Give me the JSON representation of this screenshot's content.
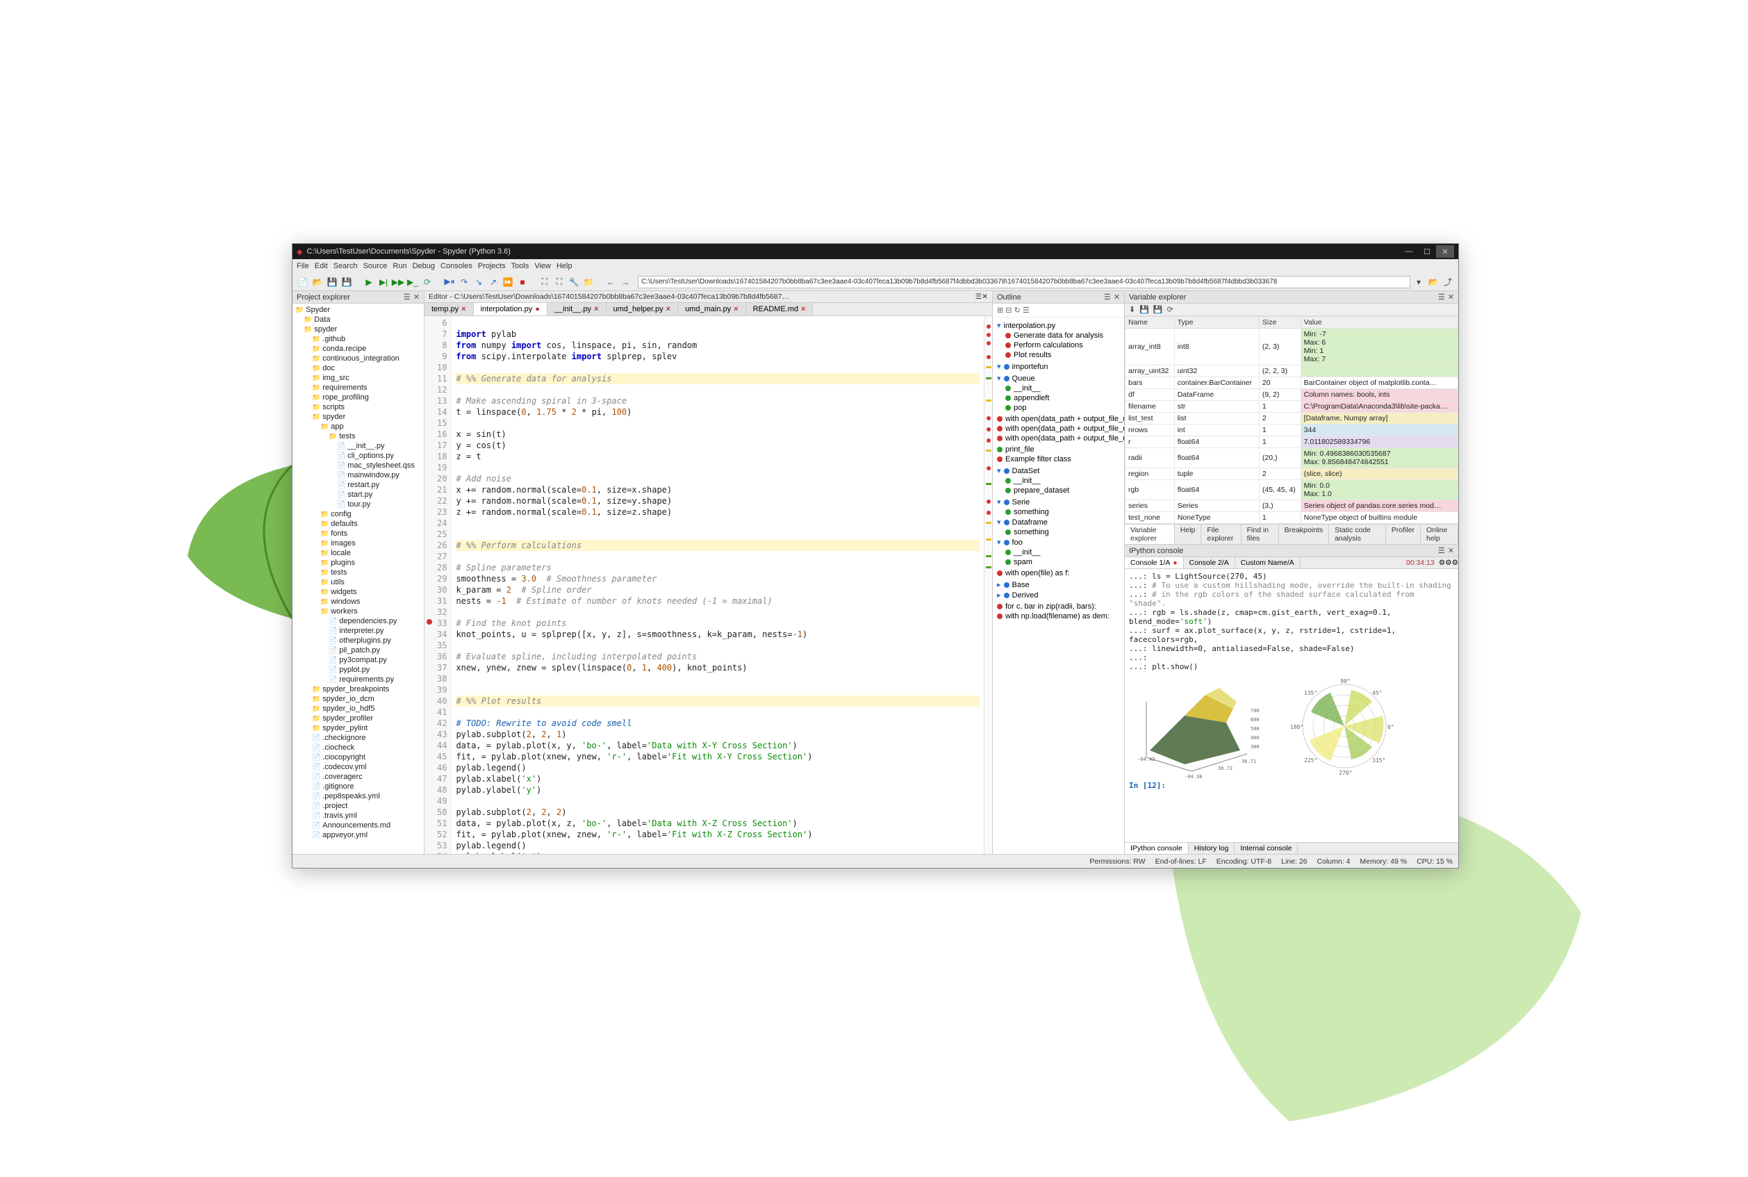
{
  "window": {
    "title": "C:\\Users\\TestUser\\Documents\\Spyder - Spyder (Python 3.6)"
  },
  "menubar": [
    "File",
    "Edit",
    "Search",
    "Source",
    "Run",
    "Debug",
    "Consoles",
    "Projects",
    "Tools",
    "View",
    "Help"
  ],
  "toolbar": {
    "path": "C:\\Users\\TestUser\\Downloads\\167401584207b0bb8ba67c3ee3aae4-03c407feca13b09b7b8d4fb5687f4dbbd3b033678\\167401584207b0bb8ba67c3ee3aae4-03c407feca13b09b7b8d4fb5687f4dbbd3b033678"
  },
  "project_explorer": {
    "title": "Project explorer",
    "tree": [
      {
        "lvl": 0,
        "label": "Spyder",
        "type": "folder"
      },
      {
        "lvl": 1,
        "label": "Data",
        "type": "folder"
      },
      {
        "lvl": 1,
        "label": "spyder",
        "type": "folder"
      },
      {
        "lvl": 2,
        "label": ".github",
        "type": "folder"
      },
      {
        "lvl": 2,
        "label": "conda.recipe",
        "type": "folder"
      },
      {
        "lvl": 2,
        "label": "continuous_integration",
        "type": "folder"
      },
      {
        "lvl": 2,
        "label": "doc",
        "type": "folder"
      },
      {
        "lvl": 2,
        "label": "img_src",
        "type": "folder"
      },
      {
        "lvl": 2,
        "label": "requirements",
        "type": "folder"
      },
      {
        "lvl": 2,
        "label": "rope_profiling",
        "type": "folder"
      },
      {
        "lvl": 2,
        "label": "scripts",
        "type": "folder"
      },
      {
        "lvl": 2,
        "label": "spyder",
        "type": "folder"
      },
      {
        "lvl": 3,
        "label": "app",
        "type": "folder"
      },
      {
        "lvl": 4,
        "label": "tests",
        "type": "folder"
      },
      {
        "lvl": 5,
        "label": "__init__.py",
        "type": "file"
      },
      {
        "lvl": 5,
        "label": "cli_options.py",
        "type": "file"
      },
      {
        "lvl": 5,
        "label": "mac_stylesheet.qss",
        "type": "file"
      },
      {
        "lvl": 5,
        "label": "mainwindow.py",
        "type": "file"
      },
      {
        "lvl": 5,
        "label": "restart.py",
        "type": "file"
      },
      {
        "lvl": 5,
        "label": "start.py",
        "type": "file"
      },
      {
        "lvl": 5,
        "label": "tour.py",
        "type": "file"
      },
      {
        "lvl": 3,
        "label": "config",
        "type": "folder"
      },
      {
        "lvl": 3,
        "label": "defaults",
        "type": "folder"
      },
      {
        "lvl": 3,
        "label": "fonts",
        "type": "folder"
      },
      {
        "lvl": 3,
        "label": "images",
        "type": "folder"
      },
      {
        "lvl": 3,
        "label": "locale",
        "type": "folder"
      },
      {
        "lvl": 3,
        "label": "plugins",
        "type": "folder"
      },
      {
        "lvl": 3,
        "label": "tests",
        "type": "folder"
      },
      {
        "lvl": 3,
        "label": "utils",
        "type": "folder"
      },
      {
        "lvl": 3,
        "label": "widgets",
        "type": "folder"
      },
      {
        "lvl": 3,
        "label": "windows",
        "type": "folder"
      },
      {
        "lvl": 3,
        "label": "workers",
        "type": "folder"
      },
      {
        "lvl": 4,
        "label": "dependencies.py",
        "type": "file"
      },
      {
        "lvl": 4,
        "label": "interpreter.py",
        "type": "file"
      },
      {
        "lvl": 4,
        "label": "otherplugins.py",
        "type": "file"
      },
      {
        "lvl": 4,
        "label": "pil_patch.py",
        "type": "file"
      },
      {
        "lvl": 4,
        "label": "py3compat.py",
        "type": "file"
      },
      {
        "lvl": 4,
        "label": "pyplot.py",
        "type": "file"
      },
      {
        "lvl": 4,
        "label": "requirements.py",
        "type": "file"
      },
      {
        "lvl": 2,
        "label": "spyder_breakpoints",
        "type": "folder"
      },
      {
        "lvl": 2,
        "label": "spyder_io_dcm",
        "type": "folder"
      },
      {
        "lvl": 2,
        "label": "spyder_io_hdf5",
        "type": "folder"
      },
      {
        "lvl": 2,
        "label": "spyder_profiler",
        "type": "folder"
      },
      {
        "lvl": 2,
        "label": "spyder_pylint",
        "type": "folder"
      },
      {
        "lvl": 2,
        "label": ".checkignore",
        "type": "file"
      },
      {
        "lvl": 2,
        "label": ".ciocheck",
        "type": "file"
      },
      {
        "lvl": 2,
        "label": ".ciocopyright",
        "type": "file"
      },
      {
        "lvl": 2,
        "label": ".codecov.yml",
        "type": "file"
      },
      {
        "lvl": 2,
        "label": ".coveragerc",
        "type": "file"
      },
      {
        "lvl": 2,
        "label": ".gitignore",
        "type": "file"
      },
      {
        "lvl": 2,
        "label": ".pep8speaks.yml",
        "type": "file"
      },
      {
        "lvl": 2,
        "label": ".project",
        "type": "file"
      },
      {
        "lvl": 2,
        "label": ".travis.yml",
        "type": "file"
      },
      {
        "lvl": 2,
        "label": "Announcements.md",
        "type": "file"
      },
      {
        "lvl": 2,
        "label": "appveyor.yml",
        "type": "file"
      }
    ]
  },
  "editor": {
    "header": "Editor - C:\\Users\\TestUser\\Downloads\\167401584207b0bb8ba67c3ee3aae4-03c407feca13b09b7b8d4fb5687f4dbbd3b033678\\167401584207b0bb8ba67c3ee3aae4-...",
    "tabs": [
      {
        "name": "temp.py",
        "active": false,
        "dirty": false
      },
      {
        "name": "interpolation.py",
        "active": true,
        "dirty": true
      },
      {
        "name": "__init__.py",
        "active": false,
        "dirty": false
      },
      {
        "name": "umd_helper.py",
        "active": false,
        "dirty": false
      },
      {
        "name": "umd_main.py",
        "active": false,
        "dirty": false
      },
      {
        "name": "README.md",
        "active": false,
        "dirty": false
      }
    ],
    "first_line_no": 6,
    "lines": [
      {
        "n": 6,
        "html": ""
      },
      {
        "n": 7,
        "html": "<span class='c-kw'>import</span> pylab"
      },
      {
        "n": 8,
        "html": "<span class='c-kw'>from</span> numpy <span class='c-kw'>import</span> cos, linspace, pi, sin, random"
      },
      {
        "n": 9,
        "html": "<span class='c-kw'>from</span> scipy.interpolate <span class='c-kw'>import</span> splprep, splev"
      },
      {
        "n": 10,
        "html": ""
      },
      {
        "n": 11,
        "html": "<span class='c-cell'><span class='c-com'># %% Generate data for analysis</span></span>"
      },
      {
        "n": 12,
        "html": ""
      },
      {
        "n": 13,
        "html": "<span class='c-com'># Make ascending spiral in 3-space</span>"
      },
      {
        "n": 14,
        "html": "t = linspace(<span class='c-num'>0</span>, <span class='c-num'>1.75</span> * <span class='c-num'>2</span> * pi, <span class='c-num'>100</span>)"
      },
      {
        "n": 15,
        "html": ""
      },
      {
        "n": 16,
        "html": "x = sin(t)"
      },
      {
        "n": 17,
        "html": "y = cos(t)"
      },
      {
        "n": 18,
        "html": "z = t"
      },
      {
        "n": 19,
        "html": ""
      },
      {
        "n": 20,
        "html": "<span class='c-com'># Add noise</span>"
      },
      {
        "n": 21,
        "html": "x += random.normal(scale=<span class='c-num'>0.1</span>, size=x.shape)"
      },
      {
        "n": 22,
        "html": "y += random.normal(scale=<span class='c-num'>0.1</span>, size=y.shape)"
      },
      {
        "n": 23,
        "html": "z += random.normal(scale=<span class='c-num'>0.1</span>, size=z.shape)"
      },
      {
        "n": 24,
        "html": ""
      },
      {
        "n": 25,
        "html": ""
      },
      {
        "n": 26,
        "html": "<span class='c-cell'><span class='c-com'># %% Perform calculations</span></span>"
      },
      {
        "n": 27,
        "html": ""
      },
      {
        "n": 28,
        "html": "<span class='c-com'># Spline parameters</span>"
      },
      {
        "n": 29,
        "html": "smoothness = <span class='c-num'>3.0</span>  <span class='c-com'># Smoothness parameter</span>"
      },
      {
        "n": 30,
        "html": "k_param = <span class='c-num'>2</span>  <span class='c-com'># Spline order</span>"
      },
      {
        "n": 31,
        "html": "nests = <span class='c-num'>-1</span>  <span class='c-com'># Estimate of number of knots needed (-1 = maximal)</span>"
      },
      {
        "n": 32,
        "html": ""
      },
      {
        "n": 33,
        "html": "<span class='c-com'># Find the knot points</span>",
        "bp": true
      },
      {
        "n": 34,
        "html": "knot_points, u = splprep([x, y, z], s=smoothness, k=k_param, nests=<span class='c-num'>-1</span>)"
      },
      {
        "n": 35,
        "html": ""
      },
      {
        "n": 36,
        "html": "<span class='c-com'># Evaluate spline, including interpolated points</span>"
      },
      {
        "n": 37,
        "html": "xnew, ynew, znew = splev(linspace(<span class='c-num'>0</span>, <span class='c-num'>1</span>, <span class='c-num'>400</span>), knot_points)"
      },
      {
        "n": 38,
        "html": ""
      },
      {
        "n": 39,
        "html": ""
      },
      {
        "n": 40,
        "html": "<span class='c-cell'><span class='c-com'># %% Plot results</span></span>"
      },
      {
        "n": 41,
        "html": ""
      },
      {
        "n": 42,
        "html": "<span class='c-todo'># TODO: Rewrite to avoid code smell</span>"
      },
      {
        "n": 43,
        "html": "pylab.subplot(<span class='c-num'>2</span>, <span class='c-num'>2</span>, <span class='c-num'>1</span>)"
      },
      {
        "n": 44,
        "html": "data, = pylab.plot(x, y, <span class='c-str'>'bo-'</span>, label=<span class='c-str'>'Data with X-Y Cross Section'</span>)"
      },
      {
        "n": 45,
        "html": "fit, = pylab.plot(xnew, ynew, <span class='c-str'>'r-'</span>, label=<span class='c-str'>'Fit with X-Y Cross Section'</span>)"
      },
      {
        "n": 46,
        "html": "pylab.legend()"
      },
      {
        "n": 47,
        "html": "pylab.xlabel(<span class='c-str'>'x'</span>)"
      },
      {
        "n": 48,
        "html": "pylab.ylabel(<span class='c-str'>'y'</span>)"
      },
      {
        "n": 49,
        "html": ""
      },
      {
        "n": 50,
        "html": "pylab.subplot(<span class='c-num'>2</span>, <span class='c-num'>2</span>, <span class='c-num'>2</span>)"
      },
      {
        "n": 51,
        "html": "data, = pylab.plot(x, z, <span class='c-str'>'bo-'</span>, label=<span class='c-str'>'Data with X-Z Cross Section'</span>)"
      },
      {
        "n": 52,
        "html": "fit, = pylab.plot(xnew, znew, <span class='c-str'>'r-'</span>, label=<span class='c-str'>'Fit with X-Z Cross Section'</span>)"
      },
      {
        "n": 53,
        "html": "pylab.legend()"
      },
      {
        "n": 54,
        "html": "pylab.xlabel(<span class='c-str'>'x'</span>)"
      }
    ]
  },
  "outline": {
    "title": "Outline",
    "nodes": [
      {
        "lvl": 0,
        "dot": "",
        "label": "interpolation.py",
        "icon": "▾"
      },
      {
        "lvl": 1,
        "dot": "red",
        "label": "Generate data for analysis"
      },
      {
        "lvl": 1,
        "dot": "red",
        "label": "Perform calculations"
      },
      {
        "lvl": 1,
        "dot": "red",
        "label": "Plot results"
      },
      {
        "lvl": 0,
        "dot": "",
        "label": "",
        "icon": ""
      },
      {
        "lvl": 0,
        "dot": "blue",
        "label": "importefun",
        "icon": "▾"
      },
      {
        "lvl": 1,
        "dot": "",
        "label": "",
        "icon": ""
      },
      {
        "lvl": 0,
        "dot": "blue",
        "label": "Queue",
        "icon": "▾"
      },
      {
        "lvl": 1,
        "dot": "green",
        "label": "__init__"
      },
      {
        "lvl": 1,
        "dot": "green",
        "label": "appendleft"
      },
      {
        "lvl": 1,
        "dot": "green",
        "label": "pop"
      },
      {
        "lvl": 0,
        "dot": "",
        "label": "",
        "icon": ""
      },
      {
        "lvl": 0,
        "dot": "red",
        "label": "with open(data_path + output_file_n..."
      },
      {
        "lvl": 0,
        "dot": "red",
        "label": "with open(data_path + output_file_n..."
      },
      {
        "lvl": 0,
        "dot": "red",
        "label": "with open(data_path + output_file_n..."
      },
      {
        "lvl": 0,
        "dot": "",
        "label": "",
        "icon": ""
      },
      {
        "lvl": 0,
        "dot": "green",
        "label": "print_file"
      },
      {
        "lvl": 0,
        "dot": "red",
        "label": "Example filter class"
      },
      {
        "lvl": 0,
        "dot": "",
        "label": "",
        "icon": ""
      },
      {
        "lvl": 0,
        "dot": "blue",
        "label": "DataSet",
        "icon": "▾"
      },
      {
        "lvl": 1,
        "dot": "green",
        "label": "__init__"
      },
      {
        "lvl": 1,
        "dot": "green",
        "label": "prepare_dataset"
      },
      {
        "lvl": 0,
        "dot": "",
        "label": "",
        "icon": ""
      },
      {
        "lvl": 0,
        "dot": "blue",
        "label": "Serie",
        "icon": "▾"
      },
      {
        "lvl": 1,
        "dot": "green",
        "label": "something"
      },
      {
        "lvl": 0,
        "dot": "blue",
        "label": "Dataframe",
        "icon": "▾"
      },
      {
        "lvl": 1,
        "dot": "green",
        "label": "something"
      },
      {
        "lvl": 0,
        "dot": "blue",
        "label": "foo",
        "icon": "▾"
      },
      {
        "lvl": 1,
        "dot": "green",
        "label": "__init__"
      },
      {
        "lvl": 1,
        "dot": "green",
        "label": "spam"
      },
      {
        "lvl": 0,
        "dot": "",
        "label": "",
        "icon": ""
      },
      {
        "lvl": 0,
        "dot": "red",
        "label": "with open(file) as f:"
      },
      {
        "lvl": 0,
        "dot": "",
        "label": "",
        "icon": ""
      },
      {
        "lvl": 0,
        "dot": "blue",
        "label": "Base",
        "icon": "▸"
      },
      {
        "lvl": 0,
        "dot": "blue",
        "label": "Derived",
        "icon": "▸"
      },
      {
        "lvl": 0,
        "dot": "",
        "label": "",
        "icon": ""
      },
      {
        "lvl": 0,
        "dot": "red",
        "label": "for c, bar in zip(radii, bars):"
      },
      {
        "lvl": 0,
        "dot": "red",
        "label": "with np.load(filename) as dem:"
      }
    ]
  },
  "variable_explorer": {
    "title": "Variable explorer",
    "headers": [
      "Name",
      "Type",
      "Size",
      "Value"
    ],
    "rows": [
      {
        "name": "array_int8",
        "type": "int8",
        "size": "(2, 3)",
        "value": "Min: -7\nMax: 6\nMin: 1\nMax: 7",
        "cls": "val-green"
      },
      {
        "name": "array_uint32",
        "type": "uint32",
        "size": "(2, 2, 3)",
        "value": "",
        "cls": "val-green"
      },
      {
        "name": "bars",
        "type": "container.BarContainer",
        "size": "20",
        "value": "BarContainer object of matplotlib.conta…",
        "cls": ""
      },
      {
        "name": "df",
        "type": "DataFrame",
        "size": "(9, 2)",
        "value": "Column names: bools, ints",
        "cls": "val-pink"
      },
      {
        "name": "filename",
        "type": "str",
        "size": "1",
        "value": "C:\\ProgramData\\Anaconda3\\lib\\site-packa…",
        "cls": "val-pink"
      },
      {
        "name": "list_test",
        "type": "list",
        "size": "2",
        "value": "[Dataframe, Numpy array]",
        "cls": "val-yellow"
      },
      {
        "name": "nrows",
        "type": "int",
        "size": "1",
        "value": "344",
        "cls": "val-blue"
      },
      {
        "name": "r",
        "type": "float64",
        "size": "1",
        "value": "7.011802589334796",
        "cls": "val-purple"
      },
      {
        "name": "radii",
        "type": "float64",
        "size": "(20,)",
        "value": "Min: 0.4968386030535687\nMax: 9.856848474842551",
        "cls": "val-green"
      },
      {
        "name": "region",
        "type": "tuple",
        "size": "2",
        "value": "(slice, slice)",
        "cls": "val-yellow"
      },
      {
        "name": "rgb",
        "type": "float64",
        "size": "(45, 45, 4)",
        "value": "Min: 0.0\nMax: 1.0",
        "cls": "val-green"
      },
      {
        "name": "series",
        "type": "Series",
        "size": "(3,)",
        "value": "Series object of pandas.core.series mod…",
        "cls": "val-pink"
      },
      {
        "name": "test_none",
        "type": "NoneType",
        "size": "1",
        "value": "NoneType object of builtins module",
        "cls": ""
      }
    ],
    "bottom_tabs": [
      "Variable explorer",
      "Help",
      "File explorer",
      "Find in files",
      "Breakpoints",
      "Static code analysis",
      "Profiler",
      "Online help"
    ]
  },
  "console": {
    "title": "IPython console",
    "tabs": [
      {
        "label": "Console 1/A",
        "dirty": true,
        "active": true
      },
      {
        "label": "Console 2/A",
        "dirty": false,
        "active": false
      },
      {
        "label": "Custom Name/A",
        "dirty": false,
        "active": false
      }
    ],
    "timer": "00:34:13",
    "lines": [
      "   ...: ls = LightSource(270, 45)",
      "   ...: # To use a custom hillshading mode, override the built-in shading",
      "   ...: # in the rgb colors of the shaded surface calculated from \"shade\".",
      "   ...: rgb = ls.shade(z, cmap=cm.gist_earth, vert_exag=0.1, blend_mode='soft')",
      "   ...: surf = ax.plot_surface(x, y, z, rstride=1, cstride=1, facecolors=rgb,",
      "   ...:                        linewidth=0, antialiased=False, shade=False)",
      "   ...: ",
      "   ...: plt.show()"
    ],
    "prompt": "In [12]:",
    "bottom_tabs": [
      "IPython console",
      "History log",
      "Internal console"
    ]
  },
  "statusbar": {
    "permissions": "Permissions: RW",
    "eol": "End-of-lines: LF",
    "encoding": "Encoding: UTF-8",
    "line": "Line: 26",
    "column": "Column: 4",
    "memory": "Memory: 49 %",
    "cpu": "CPU: 15 %"
  }
}
